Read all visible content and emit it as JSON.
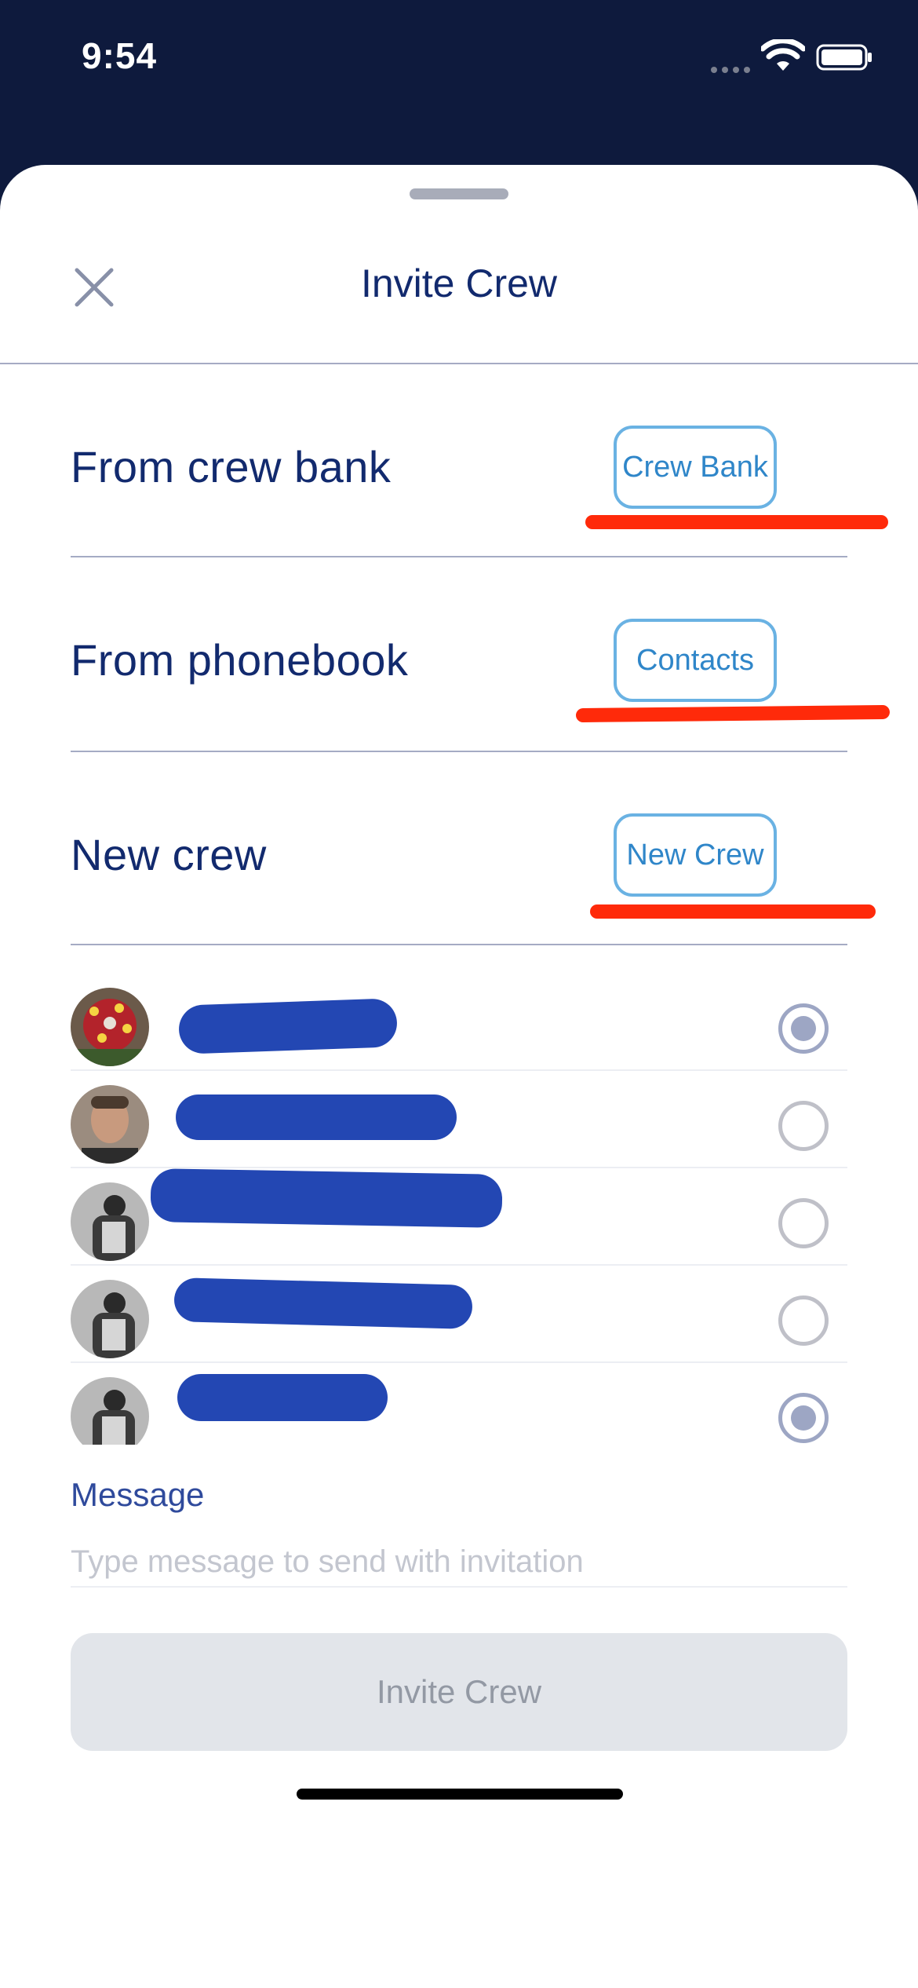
{
  "status_bar": {
    "time": "9:54"
  },
  "sheet": {
    "title": "Invite Crew",
    "sections": [
      {
        "label": "From crew bank",
        "button": "Crew Bank"
      },
      {
        "label": "From phonebook",
        "button": "Contacts"
      },
      {
        "label": "New crew",
        "button": "New Crew"
      }
    ]
  },
  "crew_list": [
    {
      "selected": true,
      "avatar": "flower-avatar"
    },
    {
      "selected": false,
      "avatar": "man-portrait-avatar"
    },
    {
      "selected": false,
      "avatar": "bw-crew-avatar"
    },
    {
      "selected": false,
      "avatar": "bw-crew-avatar"
    },
    {
      "selected": true,
      "avatar": "bw-crew-avatar"
    },
    {
      "selected": true,
      "avatar": "bw-crew-avatar"
    },
    {
      "selected": false,
      "avatar": "woman-portrait-avatar"
    }
  ],
  "message": {
    "label": "Message",
    "placeholder": "Type message to send with invitation",
    "value": ""
  },
  "invite_button": {
    "label": "Invite Crew",
    "enabled": false
  },
  "colors": {
    "navy": "#0e1a3d",
    "title": "#122a6e",
    "pill_border": "#6ab2e3",
    "pill_text": "#2f86c9",
    "annotation_red": "#ff2a0a",
    "redaction_blue": "#2347b3",
    "radio_selected": "#9da6c4"
  }
}
